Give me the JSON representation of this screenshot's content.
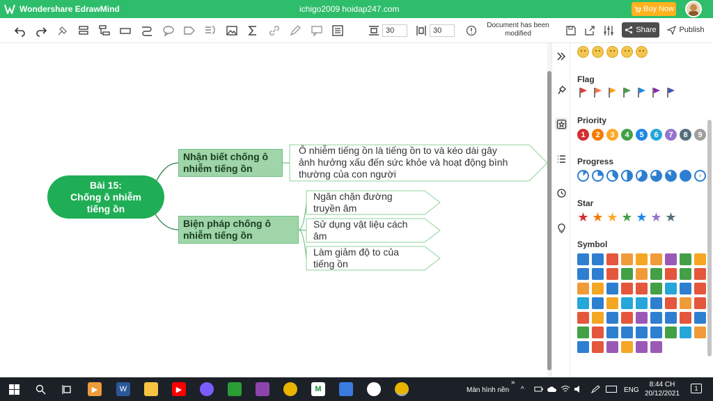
{
  "titlebar": {
    "app_name": "Wondershare EdrawMind",
    "user_title": "ichigo2009 hoidap247.com",
    "buy_now": "Buy Now"
  },
  "toolbar": {
    "spacing_h": "30",
    "spacing_v": "30",
    "doc_status": "Document has been modified",
    "share": "Share",
    "publish": "Publish"
  },
  "mindmap": {
    "central": [
      "Bài 15:",
      "Chống ô nhiễm",
      "tiếng ồn"
    ],
    "topic1": {
      "title": [
        "Nhận biết chống ô",
        "nhiễm tiếng ồn"
      ],
      "detail": [
        "Ô nhiễm tiếng ồn là tiếng ồn to và kéo dài gây",
        "ảnh hưởng xấu đến sức khỏe và hoạt động bình",
        "thường của con người"
      ]
    },
    "topic2": {
      "title": [
        "Biện pháp chống ô",
        "nhiễm tiếng ồn"
      ],
      "subs": [
        [
          "Ngăn chặn đường",
          "truyền âm"
        ],
        [
          "Sử dụng vật liệu cách",
          "âm"
        ],
        [
          "Làm giảm độ to của",
          "tiếng ồn"
        ]
      ]
    }
  },
  "panel": {
    "flag_title": "Flag",
    "priority_title": "Priority",
    "progress_title": "Progress",
    "star_title": "Star",
    "symbol_title": "Symbol",
    "flag_colors": [
      "#e53935",
      "#ff7043",
      "#ffa000",
      "#43a047",
      "#1e88e5",
      "#8e24aa",
      "#3f51b5"
    ],
    "priorities": [
      {
        "label": "1",
        "color": "#d32f2f"
      },
      {
        "label": "2",
        "color": "#f57c00"
      },
      {
        "label": "3",
        "color": "#ffa726"
      },
      {
        "label": "4",
        "color": "#43a047"
      },
      {
        "label": "5",
        "color": "#1e88e5"
      },
      {
        "label": "6",
        "color": "#26a6d9"
      },
      {
        "label": "7",
        "color": "#9575cd"
      },
      {
        "label": "8",
        "color": "#546e7a"
      },
      {
        "label": "9",
        "color": "#9e9e9e"
      }
    ],
    "progress_levels": [
      0.125,
      0.25,
      0.375,
      0.5,
      0.625,
      0.75,
      0.875,
      1
    ],
    "star_colors": [
      "#d32f2f",
      "#f57c00",
      "#ffa726",
      "#43a047",
      "#1e88e5",
      "#9575cd",
      "#546e7a"
    ],
    "symbol_colors": [
      "#2f7fd1",
      "#2f7fd1",
      "#e4573d",
      "#f09b3a",
      "#f5a623",
      "#f09b3a",
      "#9b59b6",
      "#43a047",
      "#f5a623",
      "#2f7fd1",
      "#2f7fd1",
      "#e4573d",
      "#43a047",
      "#f09b3a",
      "#43a047",
      "#e4573d",
      "#43a047",
      "#e4573d",
      "#f09b3a",
      "#f5a623",
      "#2f7fd1",
      "#e4573d",
      "#e4573d",
      "#43a047",
      "#26a6d9",
      "#2f7fd1",
      "#e4573d",
      "#26a6d9",
      "#2f7fd1",
      "#f5a623",
      "#26a6d9",
      "#26a6d9",
      "#2f7fd1",
      "#e4573d",
      "#f09b3a",
      "#e4573d",
      "#e4573d",
      "#f5a623",
      "#2f7fd1",
      "#e4573d",
      "#9b59b6",
      "#2f7fd1",
      "#2f7fd1",
      "#e4573d",
      "#2f7fd1",
      "#43a047",
      "#e4573d",
      "#2f7fd1",
      "#2f7fd1",
      "#2f7fd1",
      "#2f7fd1",
      "#43a047",
      "#26a6d9",
      "#f09b3a",
      "#2f7fd1",
      "#e4573d",
      "#9b59b6",
      "#f5a623",
      "#9b59b6",
      "#9b59b6"
    ]
  },
  "taskbar": {
    "desktop_label": "Màn hình nền",
    "lang": "ENG",
    "time": "8:44 CH",
    "date": "20/12/2021",
    "notif_count": "1"
  }
}
